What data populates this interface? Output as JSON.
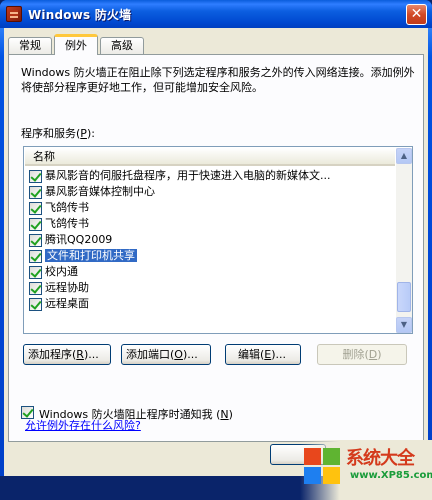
{
  "window": {
    "title": "Windows 防火墙",
    "close_glyph": "✕"
  },
  "tabs": [
    {
      "label": "常规"
    },
    {
      "label": "例外"
    },
    {
      "label": "高级"
    }
  ],
  "description": "Windows 防火墙正在阻止除下列选定程序和服务之外的传入网络连接。添加例外将使部分程序更好地工作，但可能增加安全风险。",
  "programs": {
    "label": "程序和服务",
    "accel": "P",
    "column_header": "名称",
    "items": [
      {
        "label": "暴风影音的伺服托盘程序，用于快速进入电脑的新媒体文...",
        "checked": true
      },
      {
        "label": "暴风影音媒体控制中心",
        "checked": true
      },
      {
        "label": "飞鸽传书",
        "checked": true
      },
      {
        "label": "飞鸽传书",
        "checked": true
      },
      {
        "label": "腾讯QQ2009",
        "checked": true
      },
      {
        "label": "文件和打印机共享",
        "checked": true,
        "selected": true
      },
      {
        "label": "校内通",
        "checked": true
      },
      {
        "label": "远程协助",
        "checked": true
      },
      {
        "label": "远程桌面",
        "checked": true
      }
    ]
  },
  "buttons": {
    "add_program": {
      "label": "添加程序",
      "accel": "R",
      "suffix": "..."
    },
    "add_port": {
      "label": "添加端口",
      "accel": "O",
      "suffix": "..."
    },
    "edit": {
      "label": "编辑",
      "accel": "E",
      "suffix": "..."
    },
    "delete": {
      "label": "删除",
      "accel": "D",
      "suffix": ""
    }
  },
  "notify": {
    "label": "Windows 防火墙阻止程序时通知我",
    "accel": "N",
    "checked": true
  },
  "risk_link": "允许例外存在什么风险?",
  "watermark": {
    "title": "系统大全",
    "url": "www.XP85.com"
  },
  "colors": {
    "accent": "#316ac5",
    "titlebar": "#0054e3",
    "check": "#21a121"
  }
}
